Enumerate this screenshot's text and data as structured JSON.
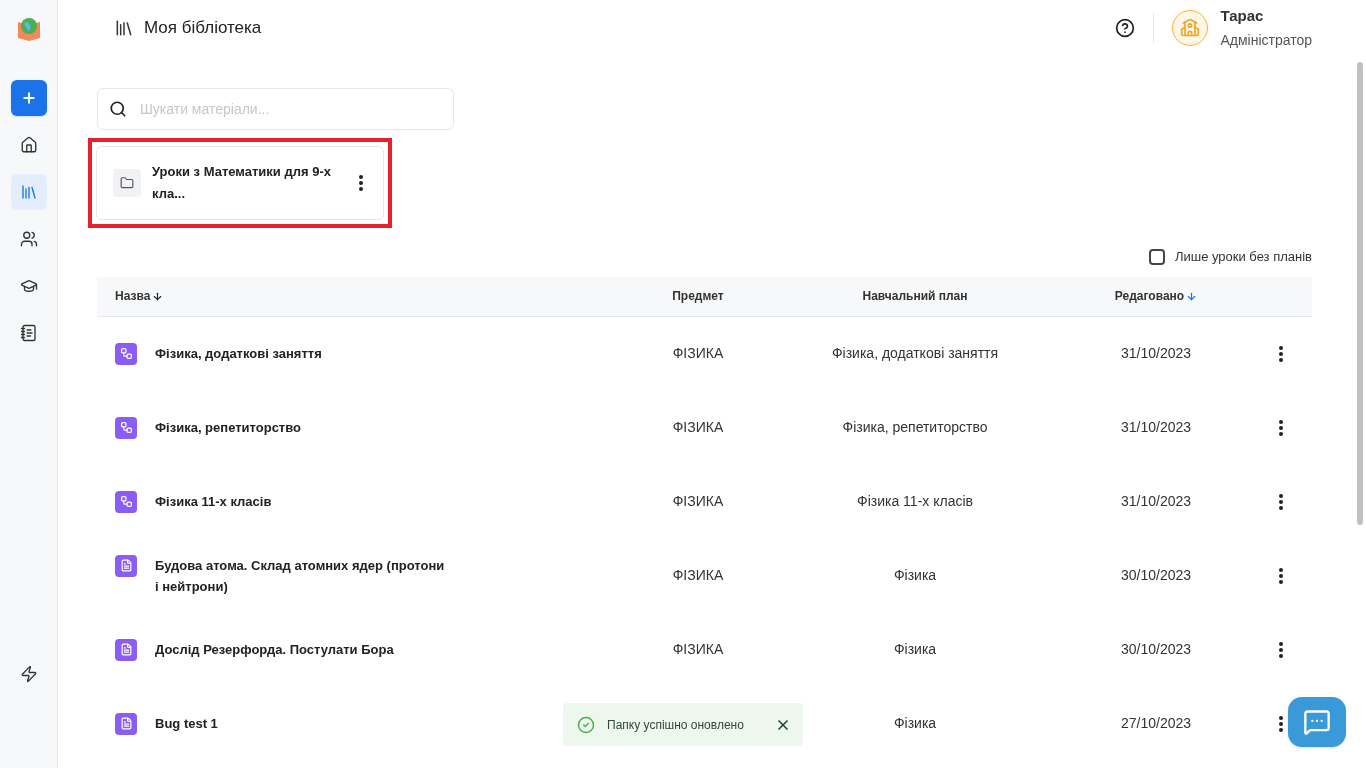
{
  "sidebar": {
    "items": [
      {
        "kind": "home",
        "selected": false
      },
      {
        "kind": "library",
        "selected": true
      },
      {
        "kind": "users",
        "selected": false
      },
      {
        "kind": "courses",
        "selected": false
      },
      {
        "kind": "notebook",
        "selected": false
      }
    ]
  },
  "header": {
    "title": "Моя бібліотека",
    "user": {
      "name": "Тарас",
      "role": "Адміністратор"
    }
  },
  "search": {
    "placeholder": "Шукати матеріали..."
  },
  "folders": [
    {
      "name": "Уроки з Математики для 9-х кла...",
      "highlighted": true
    }
  ],
  "filter": {
    "label": "Лише уроки без планів",
    "checked": false
  },
  "table": {
    "columns": [
      {
        "label": "Назва",
        "sorted": true,
        "active": false
      },
      {
        "label": "Предмет",
        "sorted": false
      },
      {
        "label": "Навчальний план",
        "sorted": false
      },
      {
        "label": "Редаговано",
        "sorted": true,
        "active": true
      }
    ],
    "rows": [
      {
        "kind": "plan",
        "name": "Фізика, додаткові заняття",
        "subject": "ФІЗИКА",
        "plan": "Фізика, додаткові заняття",
        "edited": "31/10/2023"
      },
      {
        "kind": "plan",
        "name": "Фізика, репетиторство",
        "subject": "ФІЗИКА",
        "plan": "Фізика, репетиторство",
        "edited": "31/10/2023"
      },
      {
        "kind": "plan",
        "name": "Фізика 11-х класів",
        "subject": "ФІЗИКА",
        "plan": "Фізика 11-х класів",
        "edited": "31/10/2023"
      },
      {
        "kind": "lesson",
        "name": "Будова атома. Склад атомних ядер (протони і нейтрони)",
        "subject": "ФІЗИКА",
        "plan": "Фізика",
        "edited": "30/10/2023"
      },
      {
        "kind": "lesson",
        "name": "Дослід Резерфорда. Постулати Бора",
        "subject": "ФІЗИКА",
        "plan": "Фізика",
        "edited": "30/10/2023"
      },
      {
        "kind": "lesson",
        "name": "Bug test 1",
        "plan": "Фізика",
        "edited": "27/10/2023"
      }
    ]
  },
  "toast": {
    "message": "Папку успішно оновлено"
  }
}
